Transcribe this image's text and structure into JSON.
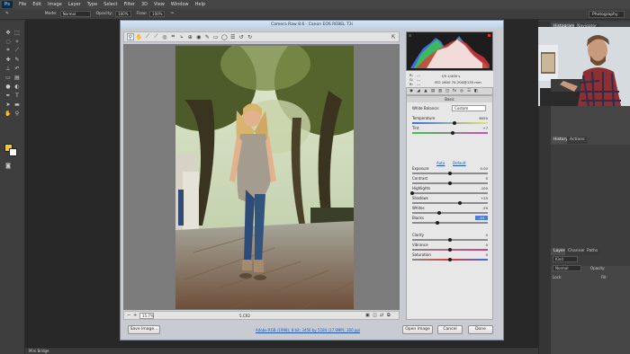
{
  "photoshop": {
    "logo": "Ps",
    "menu": [
      "File",
      "Edit",
      "Image",
      "Layer",
      "Type",
      "Select",
      "Filter",
      "3D",
      "View",
      "Window",
      "Help"
    ],
    "options": {
      "mode_label": "Mode:",
      "mode_value": "Normal",
      "opacity_label": "Opacity:",
      "opacity_value": "100%",
      "flow_label": "Flow:",
      "flow_value": "100%"
    },
    "workspace": "Photography",
    "panel_tabs_top": [
      "Histogram",
      "Navigator"
    ],
    "panel_tabs_mid": [
      "History",
      "Actions"
    ],
    "panel_tabs_bottom": [
      "Layers",
      "Channels",
      "Paths"
    ],
    "layers_kind": "Kind",
    "layers_blend": "Normal",
    "layers_opacity_label": "Opacity:",
    "layers_lock_label": "Lock:",
    "layers_fill_label": "Fill:",
    "mini_bridge": "Mini Bridge",
    "fg_color": "#f2c83a",
    "bg_color": "#ffffff"
  },
  "camera_raw": {
    "title": "Camera Raw 8.6  -  Canon EOS REBEL T3i",
    "zoom_value": "15.7%",
    "image_label": "5.CR2",
    "readout": {
      "r_label": "R:",
      "g_label": "G:",
      "b_label": "B:",
      "r": "---",
      "g": "---",
      "b": "---",
      "exif_line1": "f/5   1/400 s",
      "exif_line2": "ISO 1600   70-200@135 mm"
    },
    "panel_header": "Basic",
    "white_balance_label": "White Balance:",
    "white_balance_value": "Custom",
    "auto_label": "Auto",
    "default_label": "Default",
    "sliders": [
      {
        "label": "Temperature",
        "value": "6050",
        "pos": 0.56
      },
      {
        "label": "Tint",
        "value": "+7",
        "pos": 0.54
      },
      {
        "label": "Exposure",
        "value": "0.00",
        "pos": 0.5
      },
      {
        "label": "Contrast",
        "value": "0",
        "pos": 0.5
      },
      {
        "label": "Highlights",
        "value": "-100",
        "pos": 0.0
      },
      {
        "label": "Shadows",
        "value": "+25",
        "pos": 0.63
      },
      {
        "label": "Whites",
        "value": "-29",
        "pos": 0.36
      },
      {
        "label": "Blacks",
        "value": "-33",
        "pos": 0.33,
        "highlighted": true
      },
      {
        "label": "Clarity",
        "value": "0",
        "pos": 0.5
      },
      {
        "label": "Vibrance",
        "value": "0",
        "pos": 0.5
      },
      {
        "label": "Saturation",
        "value": "0",
        "pos": 0.5
      }
    ],
    "buttons": {
      "save": "Save Image...",
      "workflow": "Adobe RGB (1998); 8 bit; 3456 by 5184 (17.9MP); 300 ppi",
      "open": "Open Image",
      "cancel": "Cancel",
      "done": "Done"
    }
  }
}
